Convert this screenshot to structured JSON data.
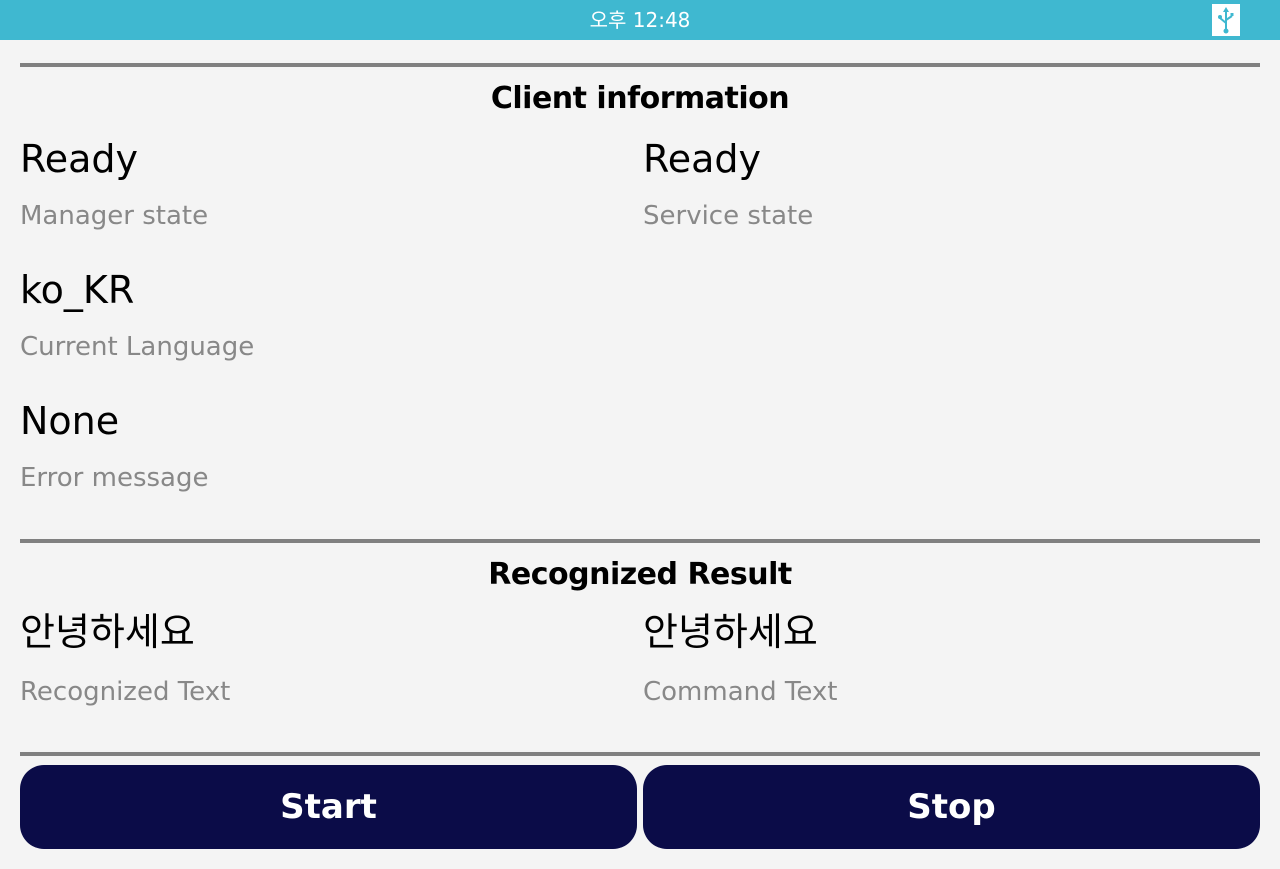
{
  "status_bar": {
    "time": "오후 12:48",
    "color": "#3fb8d0",
    "icon": "usb-icon"
  },
  "client_information": {
    "title": "Client information",
    "manager_state": {
      "value": "Ready",
      "label": "Manager state"
    },
    "service_state": {
      "value": "Ready",
      "label": "Service state"
    },
    "current_language": {
      "value": "ko_KR",
      "label": "Current Language"
    },
    "error_message": {
      "value": "None",
      "label": "Error message"
    }
  },
  "recognized_result": {
    "title": "Recognized Result",
    "recognized_text": {
      "value": "안녕하세요",
      "label": "Recognized Text"
    },
    "command_text": {
      "value": "안녕하세요",
      "label": "Command Text"
    }
  },
  "buttons": {
    "start": "Start",
    "stop": "Stop",
    "color": "#0b0c48"
  }
}
